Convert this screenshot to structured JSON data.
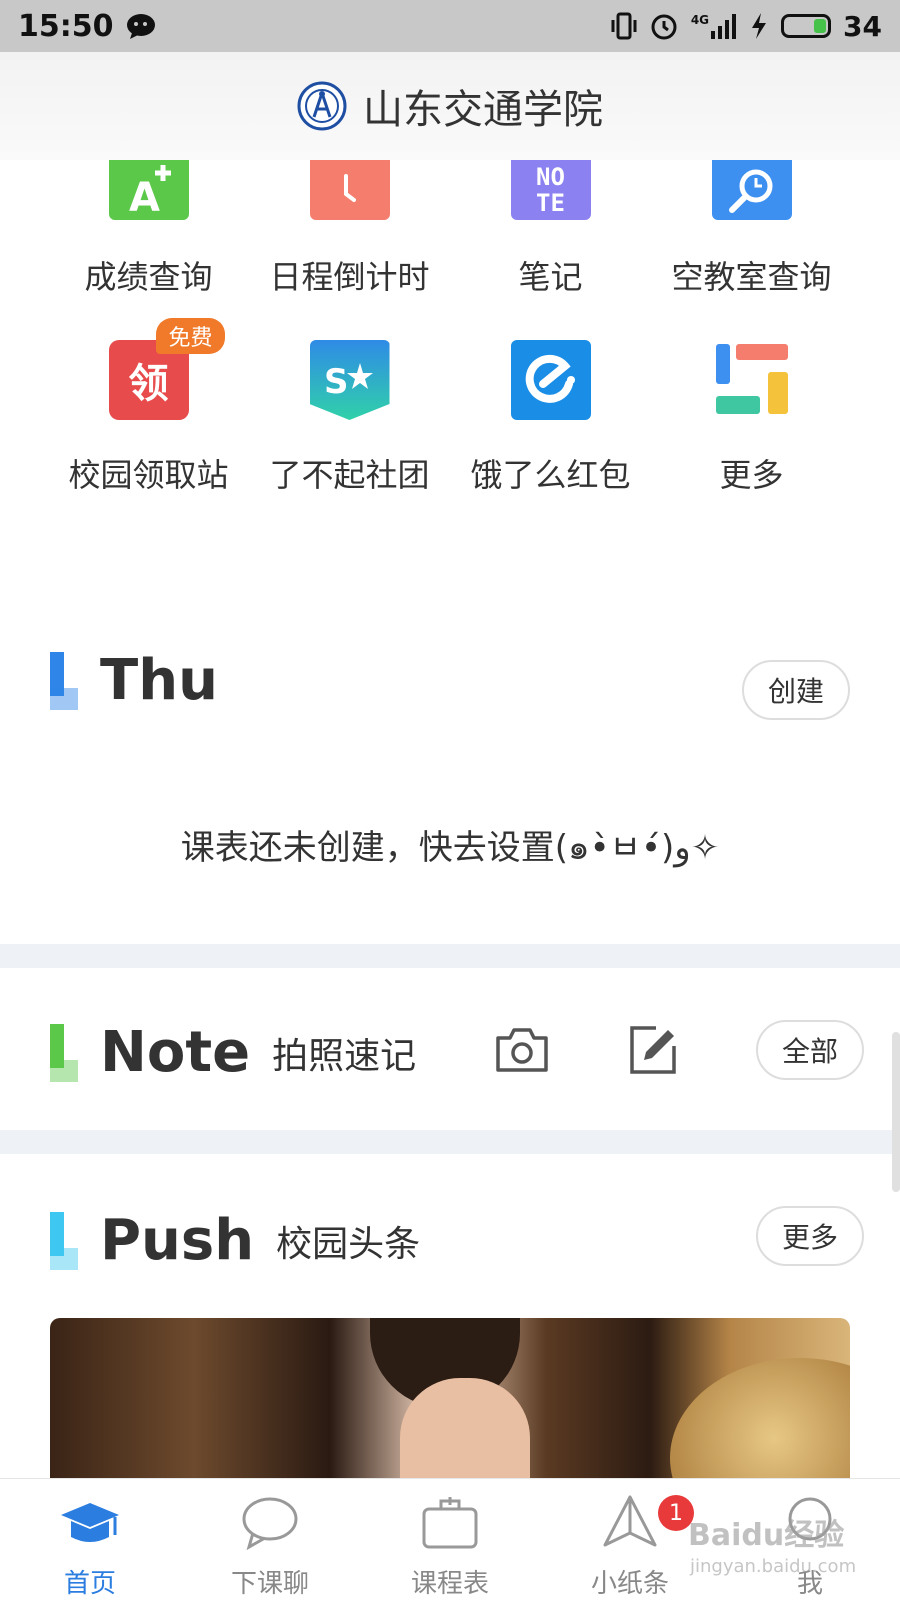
{
  "status_bar": {
    "time": "15:50",
    "network": "4G",
    "battery": "34"
  },
  "header": {
    "title": "山东交通学院"
  },
  "grid_row1": [
    {
      "label": "成绩查询",
      "icon": "grade-a-plus-icon"
    },
    {
      "label": "日程倒计时",
      "icon": "clock-icon"
    },
    {
      "label": "笔记",
      "icon": "note-icon"
    },
    {
      "label": "空教室查询",
      "icon": "classroom-search-icon"
    }
  ],
  "grid_row2": [
    {
      "label": "校园领取站",
      "icon": "ling-icon",
      "badge": "免费",
      "glyph": "领"
    },
    {
      "label": "了不起社团",
      "icon": "club-star-icon"
    },
    {
      "label": "饿了么红包",
      "icon": "eleme-icon"
    },
    {
      "label": "更多",
      "icon": "more-grid-icon"
    }
  ],
  "icons": {
    "note_top": "NO",
    "note_bottom": "TE",
    "club_letter": "S"
  },
  "schedule": {
    "title": "Thu",
    "create_label": "创建",
    "empty_message": "课表还未创建，快去设置(๑•̀ㅂ•́)و✧"
  },
  "note": {
    "title": "Note",
    "subtitle": "拍照速记",
    "all_label": "全部"
  },
  "push": {
    "title": "Push",
    "subtitle": "校园头条",
    "more_label": "更多"
  },
  "bottom_nav": [
    {
      "label": "首页",
      "icon": "graduation-cap-icon",
      "active": true
    },
    {
      "label": "下课聊",
      "icon": "chat-bubble-icon",
      "active": false
    },
    {
      "label": "课程表",
      "icon": "briefcase-icon",
      "active": false
    },
    {
      "label": "小纸条",
      "icon": "paper-plane-icon",
      "active": false,
      "badge": "1"
    },
    {
      "label": "我",
      "icon": "profile-icon",
      "active": false
    }
  ],
  "watermark": {
    "main": "Baidu经验",
    "sub": "jingyan.baidu.com"
  },
  "colors": {
    "accent": "#2b7de0",
    "note_green": "#5cc84a",
    "push_cyan": "#3ec7f0",
    "thu_blue": "#2f86e8"
  }
}
